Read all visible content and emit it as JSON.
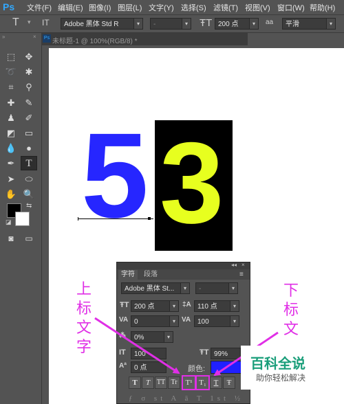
{
  "app": {
    "logo": "Ps"
  },
  "menu": [
    "文件(F)",
    "编辑(E)",
    "图像(I)",
    "图层(L)",
    "文字(Y)",
    "选择(S)",
    "滤镜(T)",
    "视图(V)",
    "窗口(W)",
    "帮助(H)"
  ],
  "options": {
    "tool_glyph": "T",
    "orient_glyph": "IT",
    "font_family": "Adobe 黑体 Std R",
    "font_style": "-",
    "font_size": "200 点",
    "aa_label": "aa",
    "aa_value": "平滑"
  },
  "document": {
    "tab_title": "未标题-1 @ 100%(RGB/8) *"
  },
  "canvas_text": {
    "digit_left": "5",
    "digit_right": "3"
  },
  "panel": {
    "tabs": [
      "字符",
      "段落"
    ],
    "font_family": "Adobe 黑体 St...",
    "font_style": "-",
    "size": "200 点",
    "leading": "110 点",
    "kerning": "0",
    "tracking": "100",
    "tsume": "0%",
    "vscale": "100",
    "hscale": "99%",
    "baseline": "0 点",
    "color_label": "颜色:",
    "style_buttons": [
      "T",
      "T",
      "TT",
      "Tr",
      "T¹",
      "T₁",
      "T",
      "Ŧ"
    ]
  },
  "annotations": {
    "superscript": [
      "上",
      "标",
      "文",
      "字"
    ],
    "subscript": [
      "下",
      "标",
      "文"
    ]
  },
  "watermark": {
    "title": "百科全说",
    "subtitle": "助你轻松解决"
  },
  "colors": {
    "accent": "#e02fe6",
    "digit_left": "#2626ff",
    "digit_right": "#e7ff1f"
  }
}
